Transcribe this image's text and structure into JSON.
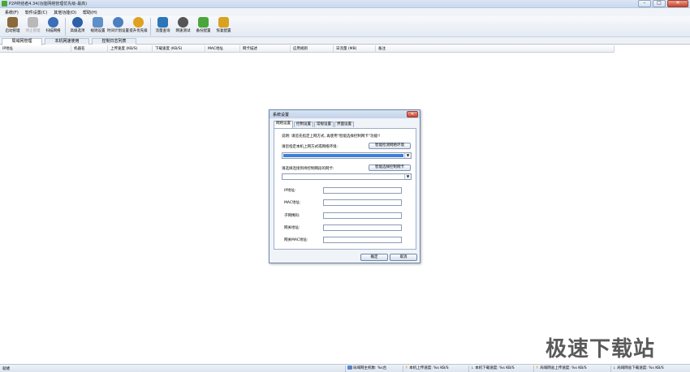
{
  "window": {
    "title": "P2P终结者4.34(功能网络管理优先级-最高)",
    "minimize": "–",
    "maximize": "□",
    "close": "✕"
  },
  "menu": [
    "系统(F)",
    "软件设置(C)",
    "其他功能(O)",
    "帮助(H)"
  ],
  "toolbar": [
    {
      "label": "启动管理",
      "icon": "start-icon",
      "color": "#8a6a3a",
      "enabled": true
    },
    {
      "label": "停止管理",
      "icon": "stop-icon",
      "color": "#b9b9b9",
      "enabled": false
    },
    {
      "label": "扫描网络",
      "icon": "scan-icon",
      "color": "#3b6fb6",
      "enabled": true
    },
    {
      "label": "高级选项",
      "icon": "advanced-icon",
      "color": "#2f5fa8",
      "enabled": true
    },
    {
      "label": "规则设置",
      "icon": "rules-icon",
      "color": "#5f8fc8",
      "enabled": true
    },
    {
      "label": "时间计划设置",
      "icon": "clock-icon",
      "color": "#4a7fc0",
      "enabled": true
    },
    {
      "label": "提升优先级",
      "icon": "priority-icon",
      "color": "#e0a020",
      "enabled": true
    },
    {
      "label": "流量查询",
      "icon": "traffic-icon",
      "color": "#2b76b9",
      "enabled": true
    },
    {
      "label": "网速测试",
      "icon": "speedometer-icon",
      "color": "#555555",
      "enabled": true
    },
    {
      "label": "备份配置",
      "icon": "backup-icon",
      "color": "#4aa63a",
      "enabled": true
    },
    {
      "label": "恢复配置",
      "icon": "restore-icon",
      "color": "#d9a21f",
      "enabled": true
    }
  ],
  "tabs": [
    "局域网管理",
    "本机网速使用",
    "控制日志列表"
  ],
  "columns": [
    "IP地址",
    "机器名",
    "上传速度 (KB/S)",
    "下载速度 (KB/S)",
    "MAC地址",
    "网卡描述",
    "应用规则",
    "日流量 (MB)",
    "备注"
  ],
  "dialog": {
    "title": "系统设置",
    "close": "✕",
    "tabs": [
      "网络设置",
      "控制设置",
      "常规设置",
      "界面设置"
    ],
    "note": "说明: 请首先指定上网方式, 再使用\"智能选择控制网卡\"功能!!",
    "prompt1": "请您指定本机上网方式或网络环境:",
    "btn1": "智能检测网络环境",
    "prompt2": "请选择连接到待控制网段的网卡:",
    "btn2": "智能选择控制网卡",
    "fields": [
      "IP地址:",
      "MAC地址:",
      "子网掩码:",
      "网关地址:",
      "网关MAC地址:"
    ],
    "ok": "确定",
    "cancel": "取消"
  },
  "status": {
    "left": "就绪",
    "hosts": "局域网主机数: %s台",
    "up_local": "本机上传速度: %s KB/S",
    "down_local": "本机下载速度: %s KB/S",
    "up_total": "局域网总上传速度: %s KB/S",
    "down_total": "局域网总下载速度: %s KB/S"
  },
  "watermark": "极速下载站"
}
